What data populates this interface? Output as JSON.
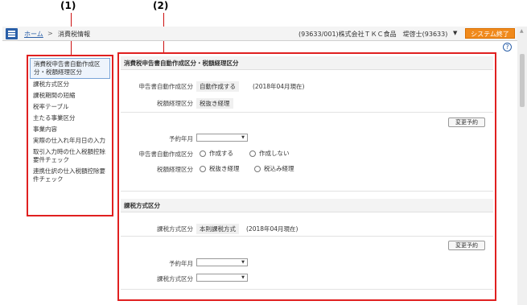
{
  "callouts": {
    "one": "(1)",
    "two": "(2)"
  },
  "header": {
    "breadcrumb_home": "ホーム",
    "breadcrumb_sep": ">",
    "breadcrumb_current": "消費税情報",
    "user_info": "(93633/001)株式会社ＴＫＣ食品　堤啓士(93633)",
    "user_caret": "▼",
    "end_button": "システム終了",
    "help": "?"
  },
  "sidebar": {
    "items": [
      {
        "label": "消費税申告書自動作成区分・税額経理区分"
      },
      {
        "label": "課税方式区分"
      },
      {
        "label": "課税期間の短縮"
      },
      {
        "label": "税率テーブル"
      },
      {
        "label": "主たる事業区分"
      },
      {
        "label": "事業内容"
      },
      {
        "label": "実際の仕入れ年月日の入力"
      },
      {
        "label": "取引入力時の仕入税額控除要件チェック"
      },
      {
        "label": "連携仕訳の仕入税額控除要件チェック"
      }
    ]
  },
  "section1": {
    "title": "消費税申告書自動作成区分・税額経理区分",
    "auto_label": "申告書自動作成区分",
    "auto_value": "自動作成する",
    "auto_note": "(2018年04月現在)",
    "tax_label": "税額経理区分",
    "tax_value": "税抜き経理",
    "change_button": "変更予約",
    "reserve_label": "予約年月",
    "reserve_caret": "▼",
    "auto_radio_label": "申告書自動作成区分",
    "auto_opt1": "作成する",
    "auto_opt2": "作成しない",
    "tax_radio_label": "税額経理区分",
    "tax_opt1": "税抜き経理",
    "tax_opt2": "税込み経理"
  },
  "section2": {
    "title": "課税方式区分",
    "method_label": "課税方式区分",
    "method_value": "本則課税方式",
    "method_note": "(2018年04月現在)",
    "change_button": "変更予約",
    "reserve_label": "予約年月",
    "reserve_caret": "▼",
    "method_select_label": "課税方式区分",
    "method_caret": "▼"
  }
}
